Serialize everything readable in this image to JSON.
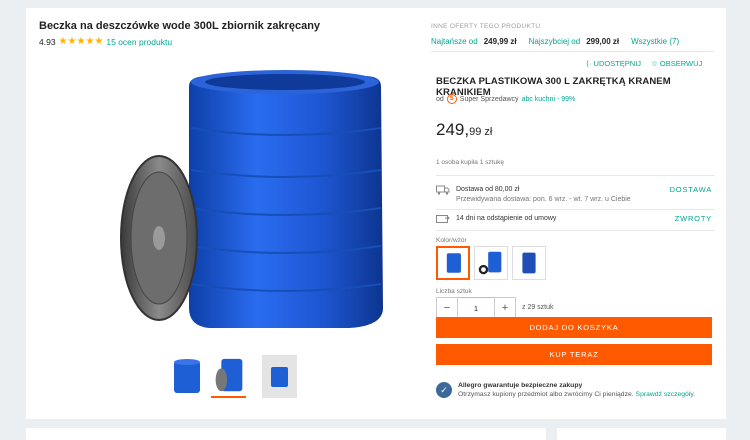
{
  "header": {
    "title": "Beczka na deszczówke wode 300L zbiornik zakręcany",
    "rating": "4.93",
    "stars": "★★★★★",
    "ratings_link": "15 ocen produktu"
  },
  "offers": {
    "label": "INNE OFERTY TEGO PRODUKTU",
    "cheapest_label": "Najtańsze od",
    "cheapest_price": "249,99 zł",
    "fastest_label": "Najszybciej od",
    "fastest_price": "299,00 zł",
    "all_label": "Wszystkie (7)"
  },
  "actions": {
    "share": "UDOSTĘPNIJ",
    "watch": "OBSERWUJ"
  },
  "product": {
    "title": "BECZKA PLASTIKOWA 300 L ZAKRĘTKĄ KRANEM KRANIKIEM",
    "seller_prefix": "od",
    "seller_badge": "S",
    "seller_type": "Super Sprzedawcy",
    "seller_name": "abc kuchni - 99%",
    "price_main": "249,",
    "price_cents": "99 zł",
    "bought": "1 osoba kupiła 1 sztukę"
  },
  "delivery": {
    "title": "Dostawa od 80,00 zł",
    "estimate": "Przewidywana dostawa: pon. 6 wrz. - wt. 7 wrz. u Ciebie",
    "action": "DOSTAWA"
  },
  "returns": {
    "text": "14 dni na odstąpienie od umowy",
    "action": "ZWROTY"
  },
  "variant": {
    "label": "Kolor/wzór",
    "swatches": [
      "blue-barrel-open",
      "blue-barrels-set",
      "blue-barrel-closed"
    ]
  },
  "quantity": {
    "label": "Liczba sztuk",
    "minus": "−",
    "value": "1",
    "plus": "+",
    "of": "z 29 sztuk"
  },
  "buttons": {
    "add_to_cart": "DODAJ DO KOSZYKA",
    "buy_now": "KUP TERAZ"
  },
  "guarantee": {
    "title": "Allegro gwarantuje bezpieczne zakupy",
    "text": "Otrzymasz kupiony przedmiot albo zwrócimy Ci pieniądze.",
    "link": "Sprawdź szczegóły."
  },
  "colors": {
    "accent": "#ff5a00",
    "link": "#00a790",
    "barrel": "#1f5fd6",
    "star": "#ffb300"
  }
}
